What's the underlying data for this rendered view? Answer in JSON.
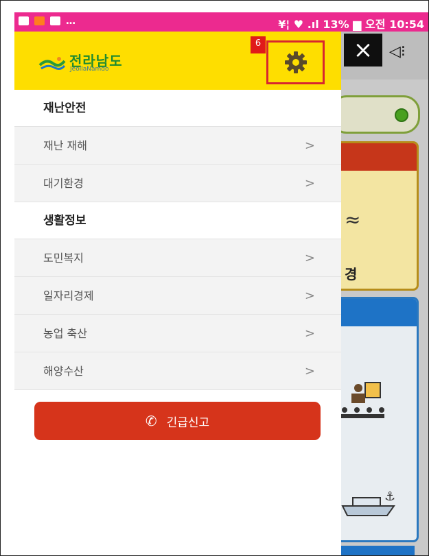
{
  "status_bar": {
    "indicators": "…",
    "right_text": "¥¦ ♥ .ıl 13% ▆ 오전 10:54"
  },
  "drawer": {
    "logo": {
      "korean": "전라남도",
      "english": "JeollaNamdo"
    },
    "badge": "6",
    "settings_icon": "gear-icon",
    "sections": [
      {
        "title": "재난안전",
        "items": [
          {
            "label": "재난 재해",
            "chevron": ">"
          },
          {
            "label": "대기환경",
            "chevron": ">"
          }
        ]
      },
      {
        "title": "생활정보",
        "items": [
          {
            "label": "도민복지",
            "chevron": ">"
          },
          {
            "label": "일자리경제",
            "chevron": ">"
          },
          {
            "label": "농업 축산",
            "chevron": ">"
          },
          {
            "label": "해양수산",
            "chevron": ">"
          }
        ]
      }
    ],
    "emergency_button": {
      "label": "긴급신고",
      "icon": "phone-icon"
    }
  },
  "background_app": {
    "close_icon": "×",
    "speaker_icon": "◁⁝",
    "card1_glyph": "≈",
    "card1_text": "경"
  },
  "colors": {
    "status_bar": "#ec2a8f",
    "header": "#fede00",
    "emergency": "#d6341b",
    "highlight_border": "#d8252f",
    "badge": "#e01a1a"
  }
}
